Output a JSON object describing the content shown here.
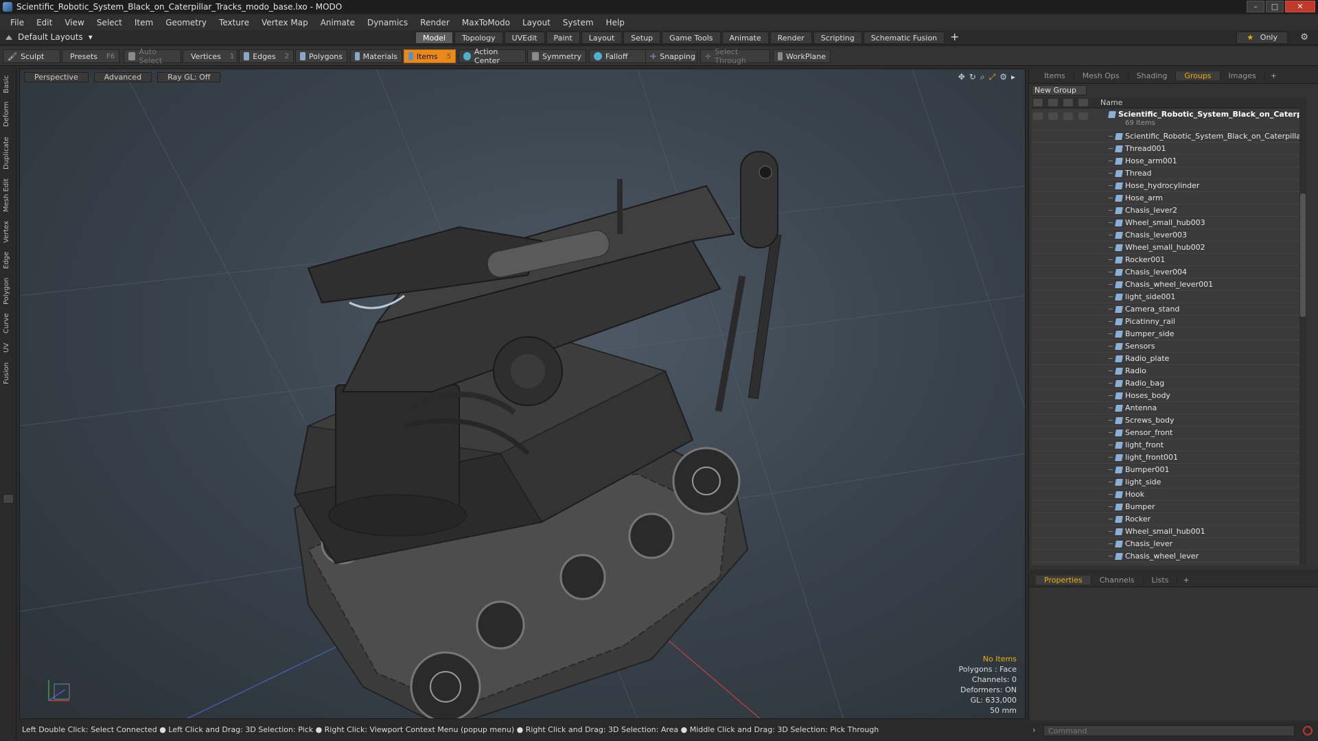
{
  "window": {
    "title": "Scientific_Robotic_System_Black_on_Caterpillar_Tracks_modo_base.lxo - MODO",
    "controls": [
      "–",
      "□",
      "✕"
    ]
  },
  "menu": [
    "File",
    "Edit",
    "View",
    "Select",
    "Item",
    "Geometry",
    "Texture",
    "Vertex Map",
    "Animate",
    "Dynamics",
    "Render",
    "MaxToModo",
    "Layout",
    "System",
    "Help"
  ],
  "layoutbar": {
    "layout_label": "Default Layouts",
    "tabs": [
      "Model",
      "Topology",
      "UVEdit",
      "Paint",
      "Layout",
      "Setup",
      "Game Tools",
      "Animate",
      "Render",
      "Scripting",
      "Schematic Fusion"
    ],
    "active_tab": "Model",
    "add_label": "+",
    "only_label": "Only"
  },
  "toolbar": {
    "sculpt": "Sculpt",
    "presets": "Presets",
    "presets_key": "F6",
    "auto_select": "Auto Select",
    "vertices": "Vertices",
    "vertices_key": "1",
    "edges": "Edges",
    "edges_key": "2",
    "polygons": "Polygons",
    "materials": "Materials",
    "items": "Items",
    "items_key": "5",
    "action_center": "Action Center",
    "symmetry": "Symmetry",
    "falloff": "Falloff",
    "snapping": "Snapping",
    "select_through": "Select Through",
    "workplane": "WorkPlane"
  },
  "lefttabs": [
    "Basic",
    "Deform",
    "Duplicate",
    "Mesh Edit",
    "Vertex",
    "Edge",
    "Polygon",
    "Curve",
    "UV",
    "Fusion"
  ],
  "viewport": {
    "buttons": [
      "Perspective",
      "Advanced",
      "Ray GL: Off"
    ],
    "stats": {
      "no_items": "No Items",
      "polygons": "Polygons : Face",
      "channels": "Channels: 0",
      "deformers": "Deformers: ON",
      "gl": "GL: 633,000",
      "focal": "50 mm"
    }
  },
  "rightpanel": {
    "tabs": [
      "Items",
      "Mesh Ops",
      "Shading",
      "Groups",
      "Images"
    ],
    "active_tab": "Groups",
    "add_label": "+",
    "new_group": "New Group",
    "name_col": "Name",
    "group": {
      "name": "Scientific_Robotic_System_Black_on_Caterpil...",
      "count": "69 Items"
    },
    "items": [
      "Scientific_Robotic_System_Black_on_Caterpillar_Tr ...",
      "Thread001",
      "Hose_arm001",
      "Thread",
      "Hose_hydrocylinder",
      "Hose_arm",
      "Chasis_lever2",
      "Wheel_small_hub003",
      "Chasis_lever003",
      "Wheel_small_hub002",
      "Rocker001",
      "Chasis_lever004",
      "Chasis_wheel_lever001",
      "light_side001",
      "Camera_stand",
      "Picatinny_rail",
      "Bumper_side",
      "Sensors",
      "Radio_plate",
      "Radio",
      "Radio_bag",
      "Hoses_body",
      "Antenna",
      "Screws_body",
      "Sensor_front",
      "light_front",
      "light_front001",
      "Bumper001",
      "light_side",
      "Hook",
      "Bumper",
      "Rocker",
      "Wheel_small_hub001",
      "Chasis_lever",
      "Chasis_wheel_lever"
    ]
  },
  "properties": {
    "tabs": [
      "Properties",
      "Channels",
      "Lists"
    ],
    "active_tab": "Properties",
    "add_label": "+"
  },
  "statusbar": {
    "text": "Left Double Click: Select Connected ● Left Click and Drag: 3D Selection: Pick ● Right Click: Viewport Context Menu (popup menu) ● Right Click and Drag: 3D Selection: Area ● Middle Click and Drag: 3D Selection: Pick Through"
  },
  "command": {
    "placeholder": "Command"
  }
}
